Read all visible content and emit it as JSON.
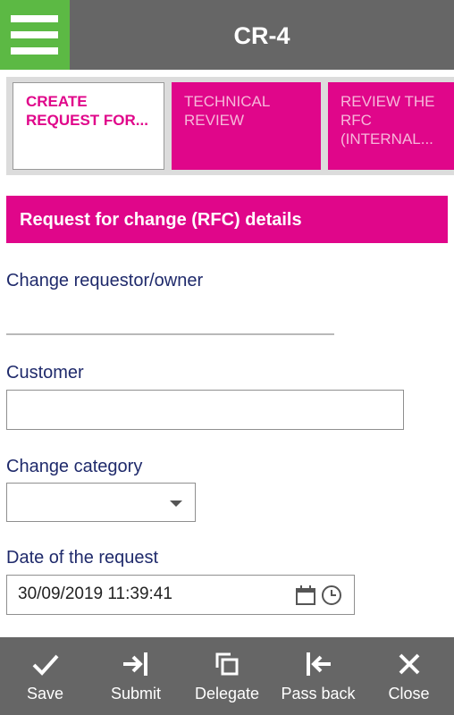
{
  "header": {
    "title": "CR-4",
    "menu_icon": "hamburger-menu-icon",
    "menu_color": "#5cb944"
  },
  "steps": [
    {
      "label": "CREATE REQUEST FOR...",
      "line1": "CREATE",
      "line2": "REQUEST FOR...",
      "line3": "",
      "active": true
    },
    {
      "label": "TECHNICAL REVIEW",
      "line1": "TECHNICAL",
      "line2": "REVIEW",
      "line3": "",
      "active": false
    },
    {
      "label": "REVIEW THE RFC (INTERNAL...",
      "line1": "REVIEW THE",
      "line2": "RFC",
      "line3": "(INTERNAL...",
      "active": false
    }
  ],
  "section": {
    "title": "Request for change (RFC) details",
    "accent": "#e0068a"
  },
  "fields": {
    "requestor": {
      "label": "Change requestor/owner",
      "value": ""
    },
    "customer": {
      "label": "Customer",
      "value": ""
    },
    "category": {
      "label": "Change category",
      "value": ""
    },
    "date": {
      "label": "Date of the request",
      "value": "30/09/2019 11:39:41",
      "icons": [
        "calendar-icon",
        "clock-icon"
      ]
    }
  },
  "actions": [
    {
      "label": "Save",
      "icon": "checkmark-icon"
    },
    {
      "label": "Submit",
      "icon": "arrow-to-bar-right-icon"
    },
    {
      "label": "Delegate",
      "icon": "copy-icon"
    },
    {
      "label": "Pass back",
      "icon": "arrow-from-bar-left-icon"
    },
    {
      "label": "Close",
      "icon": "x-close-icon"
    }
  ]
}
